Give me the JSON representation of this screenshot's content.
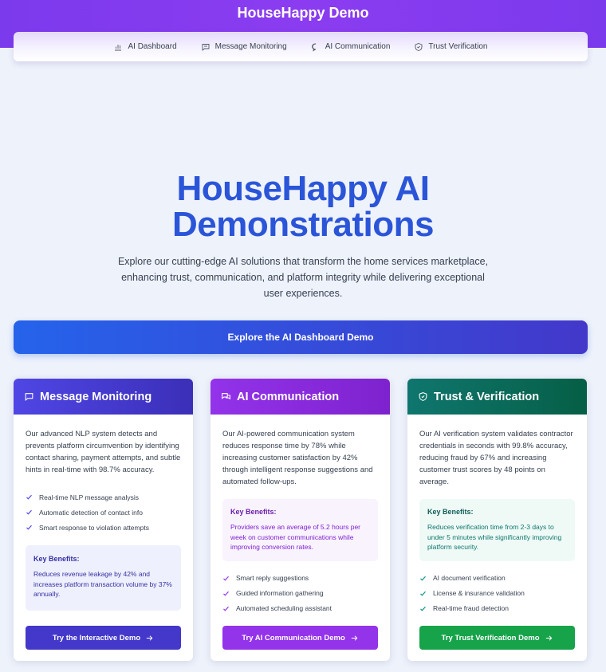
{
  "header": {
    "title": "HouseHappy Demo",
    "nav": [
      {
        "label": "AI Dashboard",
        "icon": "bar-chart-icon"
      },
      {
        "label": "Message Monitoring",
        "icon": "message-icon"
      },
      {
        "label": "AI Communication",
        "icon": "chat-bubble-icon"
      },
      {
        "label": "Trust Verification",
        "icon": "shield-icon"
      }
    ]
  },
  "hero": {
    "title_line1": "HouseHappy AI",
    "title_line2": "Demonstrations",
    "subtitle": "Explore our cutting-edge AI solutions that transform the home services marketplace, enhancing trust, communication, and platform integrity while delivering exceptional user experiences.",
    "cta_label": "Explore the AI Dashboard Demo"
  },
  "cards": [
    {
      "title": "Message Monitoring",
      "icon": "message-icon",
      "description": "Our advanced NLP system detects and prevents platform circumvention by identifying contact sharing, payment attempts, and subtle hints in real-time with 98.7% accuracy.",
      "features": [
        "Real-time NLP message analysis",
        "Automatic detection of contact info",
        "Smart response to violation attempts"
      ],
      "benefits_title": "Key Benefits:",
      "benefits_text": "Reduces revenue leakage by 42% and increases platform transaction volume by 37% annually.",
      "button_label": "Try the Interactive Demo",
      "colors": {
        "head_from": "#4f46e5",
        "head_to": "#3b2fb8",
        "btn": "#4338ca",
        "benefit_bg": "#eef0fd",
        "benefit_text": "#3730a3",
        "check": "#4f46e5"
      }
    },
    {
      "title": "AI Communication",
      "icon": "chat-bubble-icon",
      "description": "Our AI-powered communication system reduces response time by 78% while increasing customer satisfaction by 42% through intelligent response suggestions and automated follow-ups.",
      "features": [
        "Smart reply suggestions",
        "Guided information gathering",
        "Automated scheduling assistant"
      ],
      "benefits_title": "Key Benefits:",
      "benefits_text": "Providers save an average of 5.2 hours per week on customer communications while improving conversion rates.",
      "button_label": "Try AI Communication Demo",
      "colors": {
        "head_from": "#9333ea",
        "head_to": "#7e22ce",
        "btn": "#9333ea",
        "benefit_bg": "#f9f3fe",
        "benefit_text": "#7e22ce",
        "check": "#9333ea"
      }
    },
    {
      "title": "Trust & Verification",
      "icon": "shield-check-icon",
      "description": "Our AI verification system validates contractor credentials in seconds with 99.8% accuracy, reducing fraud by 67% and increasing customer trust scores by 48 points on average.",
      "features": [
        "AI document verification",
        "License & insurance validation",
        "Real-time fraud detection"
      ],
      "benefits_title": "Key Benefits:",
      "benefits_text": "Reduces verification time from 2-3 days to under 5 minutes while significantly improving platform security.",
      "button_label": "Try Trust Verification Demo",
      "colors": {
        "head_from": "#0f766e",
        "head_to": "#065f46",
        "btn": "#16a34a",
        "benefit_bg": "#effaf6",
        "benefit_text": "#0f766e",
        "check": "#0d9488"
      }
    }
  ]
}
